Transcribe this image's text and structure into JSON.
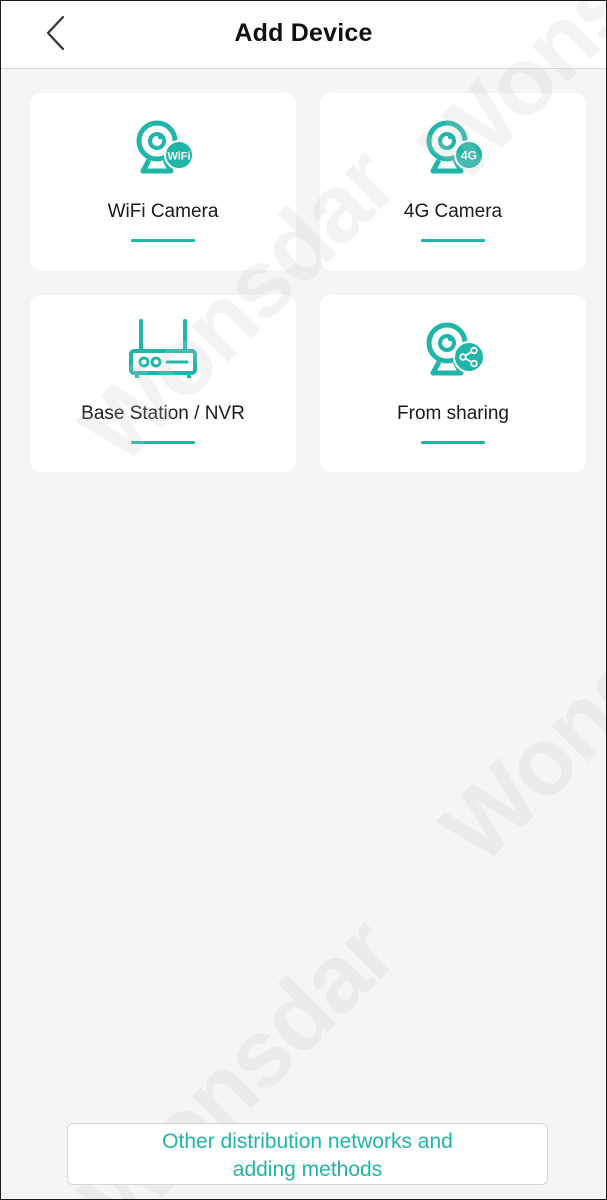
{
  "header": {
    "title": "Add Device"
  },
  "cards": [
    {
      "label": "WiFi Camera",
      "badge": "WiFi",
      "icon": "wifi-camera-icon"
    },
    {
      "label": "4G Camera",
      "badge": "4G",
      "icon": "4g-camera-icon"
    },
    {
      "label": "Base Station / NVR",
      "icon": "router-icon"
    },
    {
      "label": "From sharing",
      "icon": "shared-camera-icon"
    }
  ],
  "bottom_button": {
    "line1": "Other distribution networks and",
    "line2": "adding methods"
  },
  "watermark": "Wonsdar",
  "colors": {
    "accent": "#1fb5a8",
    "background": "#f5f5f5",
    "card": "#ffffff",
    "text": "#1a1a1a"
  }
}
